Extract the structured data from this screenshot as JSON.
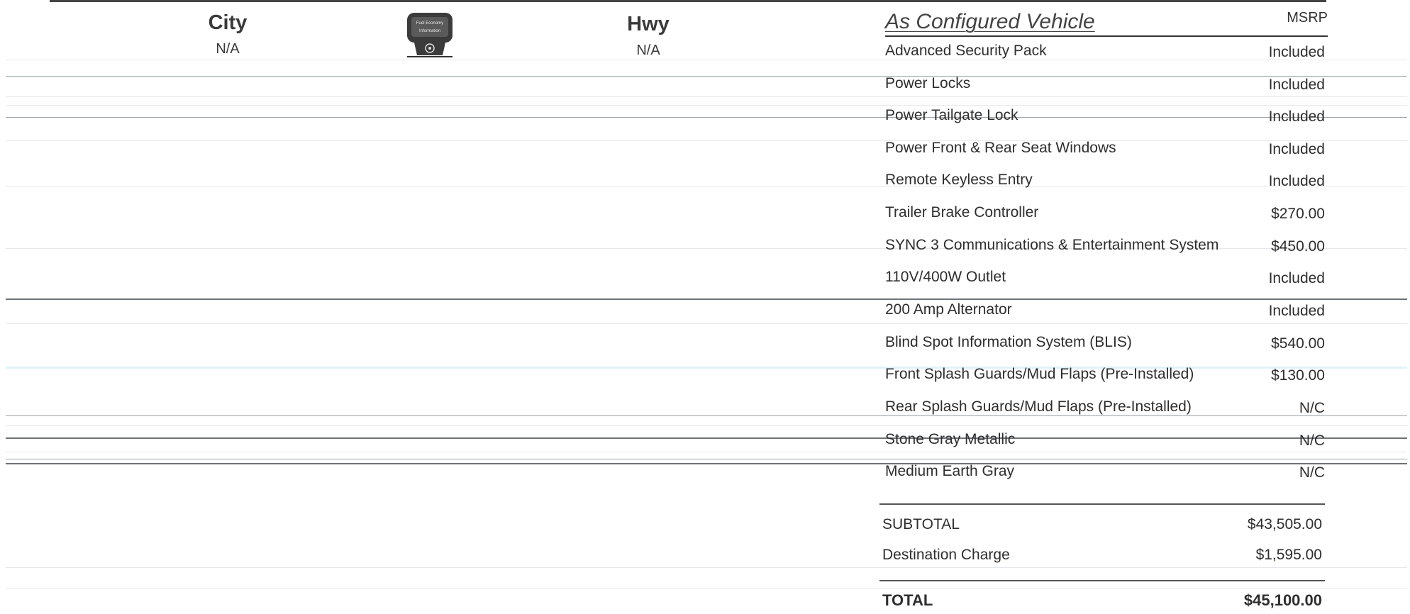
{
  "fuel_economy": {
    "city_label": "City",
    "city_value": "N/A",
    "hwy_label": "Hwy",
    "hwy_value": "N/A",
    "icon": "fuel-pump-icon",
    "icon_text": [
      "Fuel Economy",
      "Information"
    ]
  },
  "configured": {
    "title": "As Configured Vehicle",
    "price_header": "MSRP",
    "items": [
      {
        "name": "Advanced Security Pack",
        "price": "Included"
      },
      {
        "name": "Power Locks",
        "price": "Included"
      },
      {
        "name": "Power Tailgate Lock",
        "price": "Included"
      },
      {
        "name": "Power Front & Rear Seat Windows",
        "price": "Included"
      },
      {
        "name": "Remote Keyless Entry",
        "price": "Included"
      },
      {
        "name": "Trailer Brake Controller",
        "price": "$270.00"
      },
      {
        "name": "SYNC 3 Communications & Entertainment System",
        "price": "$450.00"
      },
      {
        "name": "110V/400W Outlet",
        "price": "Included"
      },
      {
        "name": "200 Amp Alternator",
        "price": "Included"
      },
      {
        "name": "Blind Spot Information System (BLIS)",
        "price": "$540.00"
      },
      {
        "name": "Front Splash Guards/Mud Flaps (Pre-Installed)",
        "price": "$130.00"
      },
      {
        "name": "Rear Splash Guards/Mud Flaps (Pre-Installed)",
        "price": "N/C"
      },
      {
        "name": "Stone Gray Metallic",
        "price": "N/C"
      },
      {
        "name": "Medium Earth Gray",
        "price": "N/C"
      }
    ]
  },
  "summary": {
    "subtotal_label": "SUBTOTAL",
    "subtotal_value": "$43,505.00",
    "destination_label": "Destination Charge",
    "destination_value": "$1,595.00",
    "total_label": "TOTAL",
    "total_value": "$45,100.00"
  }
}
